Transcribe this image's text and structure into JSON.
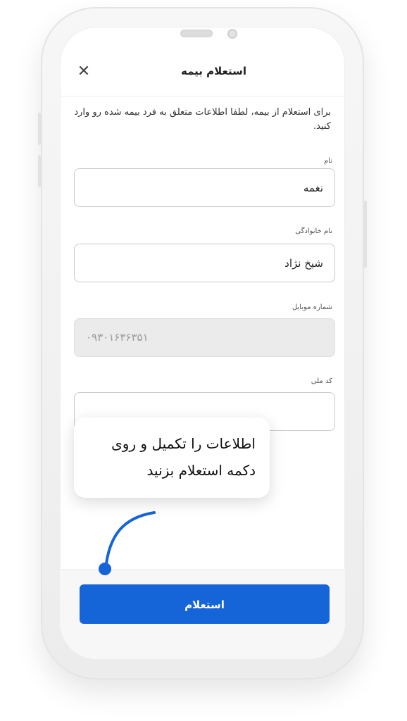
{
  "header": {
    "title": "استعلام بیمه",
    "close_icon": "close-icon"
  },
  "intro_text": "برای استعلام از بیمه، لطفا اطلاعات متعلق به فرد بیمه شده رو وارد کنید.",
  "form": {
    "first_name": {
      "label": "نام",
      "value": "نغمه"
    },
    "last_name": {
      "label": "نام خانوادگی",
      "value": "شیخ نژاد"
    },
    "mobile": {
      "label": "شماره موبایل",
      "value": "۰۹۳۰۱۶۳۶۳۵۱",
      "disabled": true
    },
    "national_code": {
      "label": "کد ملی",
      "value": ""
    }
  },
  "tooltip": {
    "line1": "اطلاعات را تکمیل و روی",
    "line2": "دکمه استعلام بزنید"
  },
  "submit_button": {
    "label": "استعلام"
  },
  "colors": {
    "primary": "#1565d8",
    "pointer": "#1565d8",
    "disabled_bg": "#ebebeb"
  }
}
